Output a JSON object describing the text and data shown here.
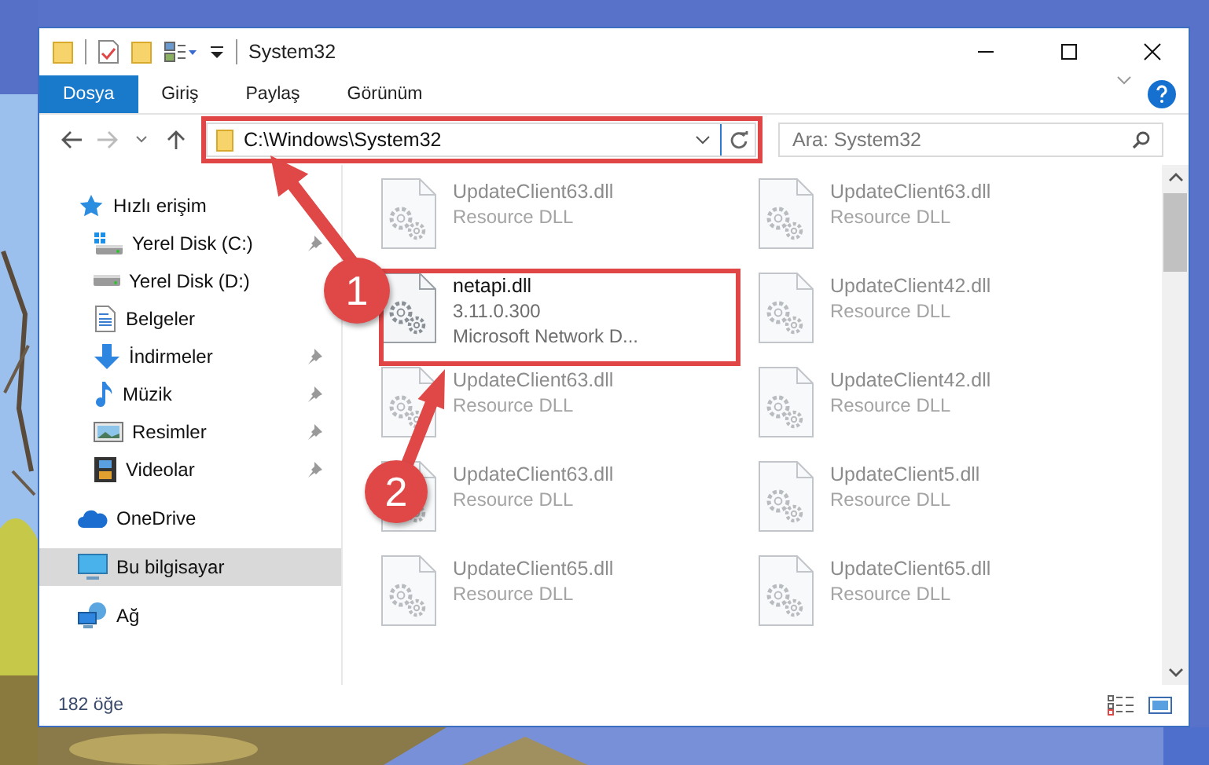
{
  "window": {
    "title": "System32"
  },
  "ribbon_tabs": [
    {
      "label": "Dosya",
      "selected": true
    },
    {
      "label": "Giriş",
      "selected": false
    },
    {
      "label": "Paylaş",
      "selected": false
    },
    {
      "label": "Görünüm",
      "selected": false
    }
  ],
  "address_bar": {
    "value": "C:\\Windows\\System32"
  },
  "search": {
    "placeholder": "Ara: System32"
  },
  "sidebar": {
    "items": [
      {
        "label": "Hızlı erişim",
        "selected": false,
        "children": [
          {
            "label": "Yerel Disk (C:)",
            "pinned": true,
            "selected": false
          },
          {
            "label": "Yerel Disk (D:)",
            "pinned": false,
            "selected": false
          },
          {
            "label": "Belgeler",
            "pinned": false,
            "selected": false
          },
          {
            "label": "İndirmeler",
            "pinned": true,
            "selected": false
          },
          {
            "label": "Müzik",
            "pinned": true,
            "selected": false
          },
          {
            "label": "Resimler",
            "pinned": true,
            "selected": false
          },
          {
            "label": "Videolar",
            "pinned": true,
            "selected": false
          }
        ]
      },
      {
        "label": "OneDrive",
        "selected": false
      },
      {
        "label": "Bu bilgisayar",
        "selected": true
      },
      {
        "label": "Ağ",
        "selected": false
      }
    ]
  },
  "files": [
    {
      "name": "UpdateClient63.dll",
      "lines": [
        "Resource DLL"
      ],
      "kind": "faded"
    },
    {
      "name": "UpdateClient63.dll",
      "lines": [
        "Resource DLL"
      ],
      "kind": "faded"
    },
    {
      "name": "netapi.dll",
      "lines": [
        "3.11.0.300",
        "Microsoft Network D..."
      ],
      "kind": "plain"
    },
    {
      "name": "UpdateClient42.dll",
      "lines": [
        "Resource DLL"
      ],
      "kind": "faded"
    },
    {
      "name": "UpdateClient63.dll",
      "lines": [
        "Resource DLL"
      ],
      "kind": "faded"
    },
    {
      "name": "UpdateClient42.dll",
      "lines": [
        "Resource DLL"
      ],
      "kind": "faded"
    },
    {
      "name": "UpdateClient63.dll",
      "lines": [
        "Resource DLL"
      ],
      "kind": "faded"
    },
    {
      "name": "UpdateClient5.dll",
      "lines": [
        "Resource DLL"
      ],
      "kind": "faded"
    },
    {
      "name": "UpdateClient65.dll",
      "lines": [
        "Resource DLL"
      ],
      "kind": "faded"
    },
    {
      "name": "UpdateClient65.dll",
      "lines": [
        "Resource DLL"
      ],
      "kind": "faded"
    }
  ],
  "status_bar": {
    "item_count": "182 öğe"
  },
  "annotations": [
    {
      "number": "1"
    },
    {
      "number": "2"
    }
  ]
}
